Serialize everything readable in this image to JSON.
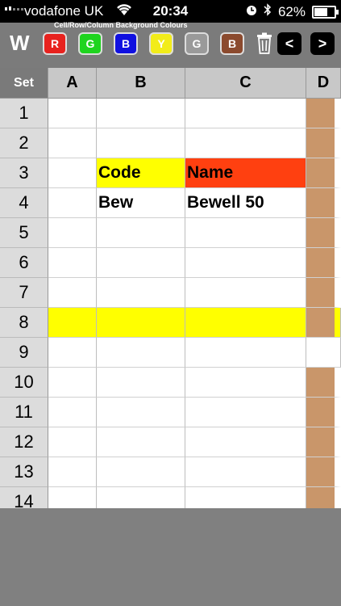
{
  "status": {
    "carrier": "vodafone UK",
    "time": "20:34",
    "battery": "62%",
    "battery_level": 0.62
  },
  "toolbar": {
    "w_label": "W",
    "caption": "Cell/Row/Column  Background Colours",
    "color_buttons": [
      {
        "label": "R",
        "color": "#e8221e"
      },
      {
        "label": "G",
        "color": "#1fd41f"
      },
      {
        "label": "B",
        "color": "#1010e0"
      },
      {
        "label": "Y",
        "color": "#f2ec19"
      },
      {
        "label": "G",
        "color": "#9a9a9a"
      },
      {
        "label": "B",
        "color": "#8b4a2e"
      }
    ],
    "prev_label": "<",
    "next_label": ">"
  },
  "sheet": {
    "set_label": "Set",
    "columns": [
      "A",
      "B",
      "C",
      "D"
    ],
    "rows": [
      "1",
      "2",
      "3",
      "4",
      "5",
      "6",
      "7",
      "8",
      "9",
      "10",
      "11",
      "12",
      "13",
      "14"
    ],
    "cells": {
      "B3": "Code",
      "C3": "Name",
      "B4": "Bew",
      "C4": "Bewell 50"
    },
    "colors": {
      "yellow": "#ffff00",
      "red": "#ff4010",
      "tan": "#c9966a"
    }
  }
}
